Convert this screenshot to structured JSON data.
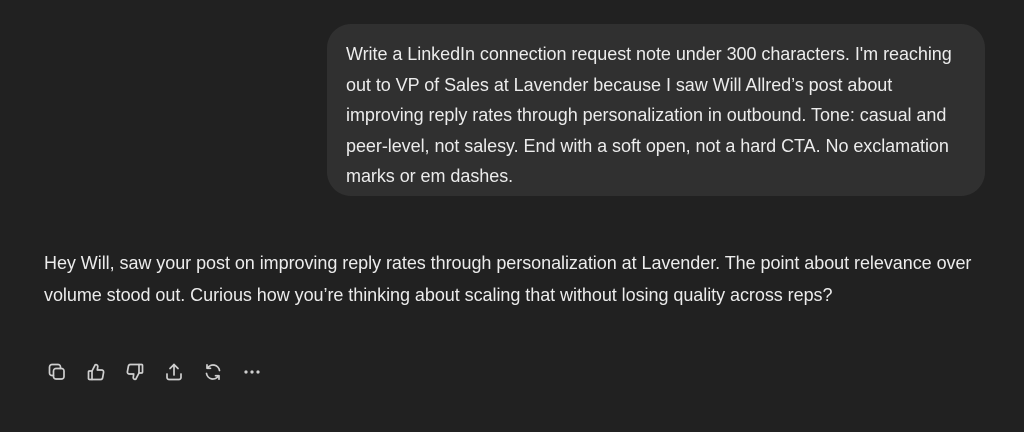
{
  "conversation": {
    "user_message": "Write a LinkedIn connection request note under 300 characters. I'm reaching out to VP of Sales at Lavender because I saw Will Allred’s post about improving reply rates through personalization in outbound. Tone: casual and peer-level, not salesy. End with a soft open, not a hard CTA. No exclamation marks or em dashes.",
    "assistant_message": "Hey Will, saw your post on improving reply rates through personalization at Lavender. The point about relevance over volume stood out. Curious how you’re thinking about scaling that without losing quality across reps?"
  },
  "actions": {
    "icons": [
      "copy-icon",
      "thumbs-up-icon",
      "thumbs-down-icon",
      "share-icon",
      "regenerate-icon",
      "more-icon"
    ]
  },
  "colors": {
    "background": "#212121",
    "user_bubble": "#303030",
    "text": "#ececec",
    "icon": "#cfcfcf"
  }
}
